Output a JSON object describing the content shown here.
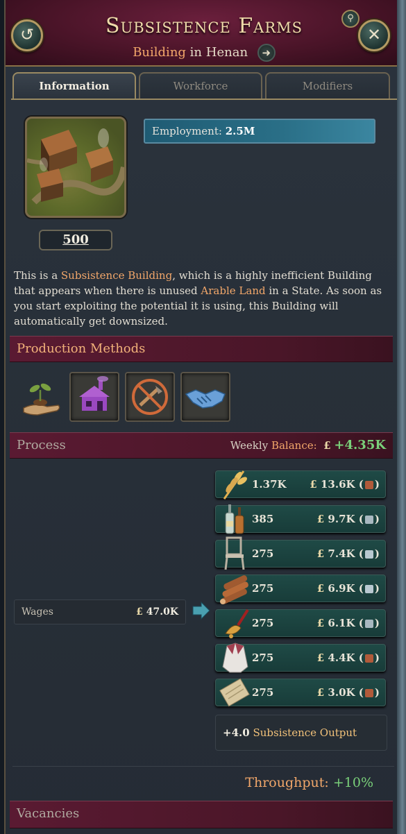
{
  "header": {
    "title": "Subsistence Farms",
    "subtitle_type": "Building",
    "subtitle_in": "in",
    "subtitle_state": "Henan"
  },
  "tabs": [
    {
      "label": "Information",
      "active": true
    },
    {
      "label": "Workforce",
      "active": false
    },
    {
      "label": "Modifiers",
      "active": false
    }
  ],
  "building": {
    "level": "500",
    "employment_label": "Employment:",
    "employment_value": "2.5M"
  },
  "description": {
    "p1": "This is a ",
    "link1": "Subsistence Building",
    "p2": ", which is a highly inefficient Building that appears when there is unused ",
    "link2": "Arable Land",
    "p3": " in a State. As soon as you start exploiting the potential it is using, this Building will automatically get downsized."
  },
  "production_methods": {
    "title": "Production Methods",
    "icons": [
      "sapling-hand-icon",
      "purple-cottage-icon",
      "no-tools-icon",
      "handshake-icon"
    ]
  },
  "process": {
    "title": "Process",
    "weekly_label": "Weekly",
    "balance_label": "Balance:",
    "currency": "£",
    "balance_value": "+4.35K",
    "wages_label": "Wages",
    "wages_value": "47.0K",
    "goods": [
      {
        "icon": "grain-icon",
        "qty": "1.37K",
        "price": "13.6K",
        "coin": "copper-coin-icon"
      },
      {
        "icon": "liquor-icon",
        "qty": "385",
        "price": "9.7K",
        "coin": "silver-coin-icon"
      },
      {
        "icon": "furniture-icon",
        "qty": "275",
        "price": "7.4K",
        "coin": "silver-stack-icon"
      },
      {
        "icon": "wood-icon",
        "qty": "275",
        "price": "6.9K",
        "coin": "silver-stack-icon"
      },
      {
        "icon": "tools-icon",
        "qty": "275",
        "price": "6.1K",
        "coin": "silver-coin-icon"
      },
      {
        "icon": "clothes-icon",
        "qty": "275",
        "price": "4.4K",
        "coin": "copper-coin-icon"
      },
      {
        "icon": "fabric-icon",
        "qty": "275",
        "price": "3.0K",
        "coin": "copper-coin-icon"
      }
    ],
    "subsistence_value": "+4.0",
    "subsistence_label": "Subsistence Output",
    "throughput_label": "Throughput:",
    "throughput_value": "+10%"
  },
  "vacancies": {
    "title": "Vacancies"
  },
  "colors": {
    "accent_orange": "#f2a76a",
    "positive_green": "#7ad07a",
    "header_crimson": "#4a1428",
    "employment_blue": "#2a6f87"
  }
}
